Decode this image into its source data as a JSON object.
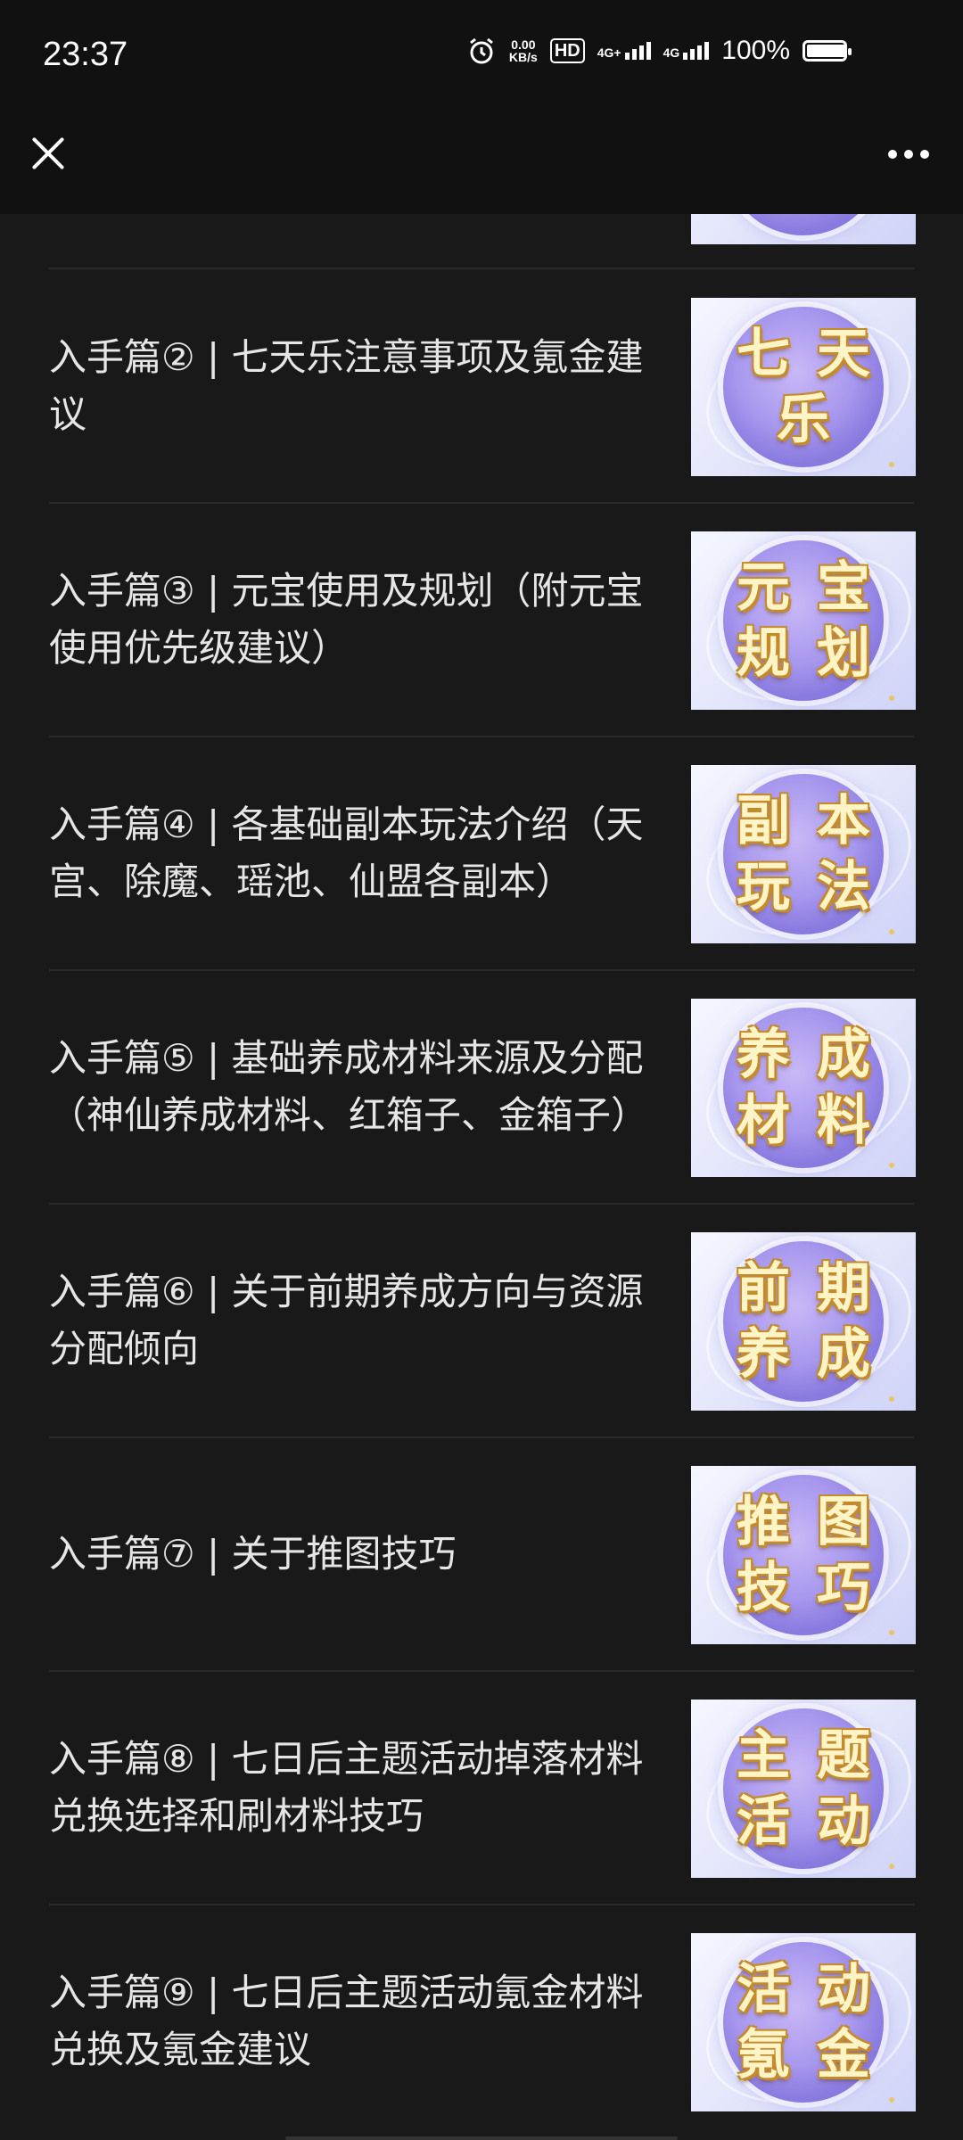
{
  "status": {
    "time": "23:37",
    "speed": "0.00",
    "speed_unit": "KB/s",
    "hd": "HD",
    "sim1": "4G+",
    "sim2": "4G",
    "battery_text": "100%",
    "battery_level": 1.0
  },
  "items": [
    {
      "title": "入手篇② | 七天乐注意事项及氪金建议",
      "thumb_chars": [
        "七",
        "天",
        "乐"
      ]
    },
    {
      "title": "入手篇③ | 元宝使用及规划（附元宝使用优先级建议）",
      "thumb_chars": [
        "元",
        "宝",
        "规",
        "划"
      ]
    },
    {
      "title": "入手篇④ | 各基础副本玩法介绍（天宫、除魔、瑶池、仙盟各副本）",
      "thumb_chars": [
        "副",
        "本",
        "玩",
        "法"
      ]
    },
    {
      "title": "入手篇⑤ | 基础养成材料来源及分配（神仙养成材料、红箱子、金箱子）",
      "thumb_chars": [
        "养",
        "成",
        "材",
        "料"
      ]
    },
    {
      "title": "入手篇⑥ | 关于前期养成方向与资源分配倾向",
      "thumb_chars": [
        "前",
        "期",
        "养",
        "成"
      ]
    },
    {
      "title": "入手篇⑦ | 关于推图技巧",
      "thumb_chars": [
        "推",
        "图",
        "技",
        "巧"
      ]
    },
    {
      "title": "入手篇⑧ | 七日后主题活动掉落材料兑换选择和刷材料技巧",
      "thumb_chars": [
        "主",
        "题",
        "活",
        "动"
      ]
    },
    {
      "title": "入手篇⑨ | 七日后主题活动氪金材料兑换及氪金建议",
      "thumb_chars": [
        "活",
        "动",
        "氪",
        "金"
      ]
    }
  ]
}
